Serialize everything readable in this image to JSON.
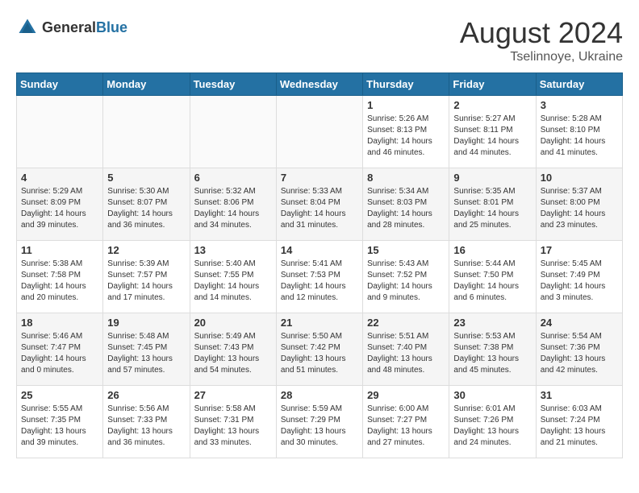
{
  "header": {
    "logo_general": "General",
    "logo_blue": "Blue",
    "month_year": "August 2024",
    "location": "Tselinnoye, Ukraine"
  },
  "days_of_week": [
    "Sunday",
    "Monday",
    "Tuesday",
    "Wednesday",
    "Thursday",
    "Friday",
    "Saturday"
  ],
  "weeks": [
    [
      {
        "day": "",
        "info": ""
      },
      {
        "day": "",
        "info": ""
      },
      {
        "day": "",
        "info": ""
      },
      {
        "day": "",
        "info": ""
      },
      {
        "day": "1",
        "info": "Sunrise: 5:26 AM\nSunset: 8:13 PM\nDaylight: 14 hours and 46 minutes."
      },
      {
        "day": "2",
        "info": "Sunrise: 5:27 AM\nSunset: 8:11 PM\nDaylight: 14 hours and 44 minutes."
      },
      {
        "day": "3",
        "info": "Sunrise: 5:28 AM\nSunset: 8:10 PM\nDaylight: 14 hours and 41 minutes."
      }
    ],
    [
      {
        "day": "4",
        "info": "Sunrise: 5:29 AM\nSunset: 8:09 PM\nDaylight: 14 hours and 39 minutes."
      },
      {
        "day": "5",
        "info": "Sunrise: 5:30 AM\nSunset: 8:07 PM\nDaylight: 14 hours and 36 minutes."
      },
      {
        "day": "6",
        "info": "Sunrise: 5:32 AM\nSunset: 8:06 PM\nDaylight: 14 hours and 34 minutes."
      },
      {
        "day": "7",
        "info": "Sunrise: 5:33 AM\nSunset: 8:04 PM\nDaylight: 14 hours and 31 minutes."
      },
      {
        "day": "8",
        "info": "Sunrise: 5:34 AM\nSunset: 8:03 PM\nDaylight: 14 hours and 28 minutes."
      },
      {
        "day": "9",
        "info": "Sunrise: 5:35 AM\nSunset: 8:01 PM\nDaylight: 14 hours and 25 minutes."
      },
      {
        "day": "10",
        "info": "Sunrise: 5:37 AM\nSunset: 8:00 PM\nDaylight: 14 hours and 23 minutes."
      }
    ],
    [
      {
        "day": "11",
        "info": "Sunrise: 5:38 AM\nSunset: 7:58 PM\nDaylight: 14 hours and 20 minutes."
      },
      {
        "day": "12",
        "info": "Sunrise: 5:39 AM\nSunset: 7:57 PM\nDaylight: 14 hours and 17 minutes."
      },
      {
        "day": "13",
        "info": "Sunrise: 5:40 AM\nSunset: 7:55 PM\nDaylight: 14 hours and 14 minutes."
      },
      {
        "day": "14",
        "info": "Sunrise: 5:41 AM\nSunset: 7:53 PM\nDaylight: 14 hours and 12 minutes."
      },
      {
        "day": "15",
        "info": "Sunrise: 5:43 AM\nSunset: 7:52 PM\nDaylight: 14 hours and 9 minutes."
      },
      {
        "day": "16",
        "info": "Sunrise: 5:44 AM\nSunset: 7:50 PM\nDaylight: 14 hours and 6 minutes."
      },
      {
        "day": "17",
        "info": "Sunrise: 5:45 AM\nSunset: 7:49 PM\nDaylight: 14 hours and 3 minutes."
      }
    ],
    [
      {
        "day": "18",
        "info": "Sunrise: 5:46 AM\nSunset: 7:47 PM\nDaylight: 14 hours and 0 minutes."
      },
      {
        "day": "19",
        "info": "Sunrise: 5:48 AM\nSunset: 7:45 PM\nDaylight: 13 hours and 57 minutes."
      },
      {
        "day": "20",
        "info": "Sunrise: 5:49 AM\nSunset: 7:43 PM\nDaylight: 13 hours and 54 minutes."
      },
      {
        "day": "21",
        "info": "Sunrise: 5:50 AM\nSunset: 7:42 PM\nDaylight: 13 hours and 51 minutes."
      },
      {
        "day": "22",
        "info": "Sunrise: 5:51 AM\nSunset: 7:40 PM\nDaylight: 13 hours and 48 minutes."
      },
      {
        "day": "23",
        "info": "Sunrise: 5:53 AM\nSunset: 7:38 PM\nDaylight: 13 hours and 45 minutes."
      },
      {
        "day": "24",
        "info": "Sunrise: 5:54 AM\nSunset: 7:36 PM\nDaylight: 13 hours and 42 minutes."
      }
    ],
    [
      {
        "day": "25",
        "info": "Sunrise: 5:55 AM\nSunset: 7:35 PM\nDaylight: 13 hours and 39 minutes."
      },
      {
        "day": "26",
        "info": "Sunrise: 5:56 AM\nSunset: 7:33 PM\nDaylight: 13 hours and 36 minutes."
      },
      {
        "day": "27",
        "info": "Sunrise: 5:58 AM\nSunset: 7:31 PM\nDaylight: 13 hours and 33 minutes."
      },
      {
        "day": "28",
        "info": "Sunrise: 5:59 AM\nSunset: 7:29 PM\nDaylight: 13 hours and 30 minutes."
      },
      {
        "day": "29",
        "info": "Sunrise: 6:00 AM\nSunset: 7:27 PM\nDaylight: 13 hours and 27 minutes."
      },
      {
        "day": "30",
        "info": "Sunrise: 6:01 AM\nSunset: 7:26 PM\nDaylight: 13 hours and 24 minutes."
      },
      {
        "day": "31",
        "info": "Sunrise: 6:03 AM\nSunset: 7:24 PM\nDaylight: 13 hours and 21 minutes."
      }
    ]
  ]
}
